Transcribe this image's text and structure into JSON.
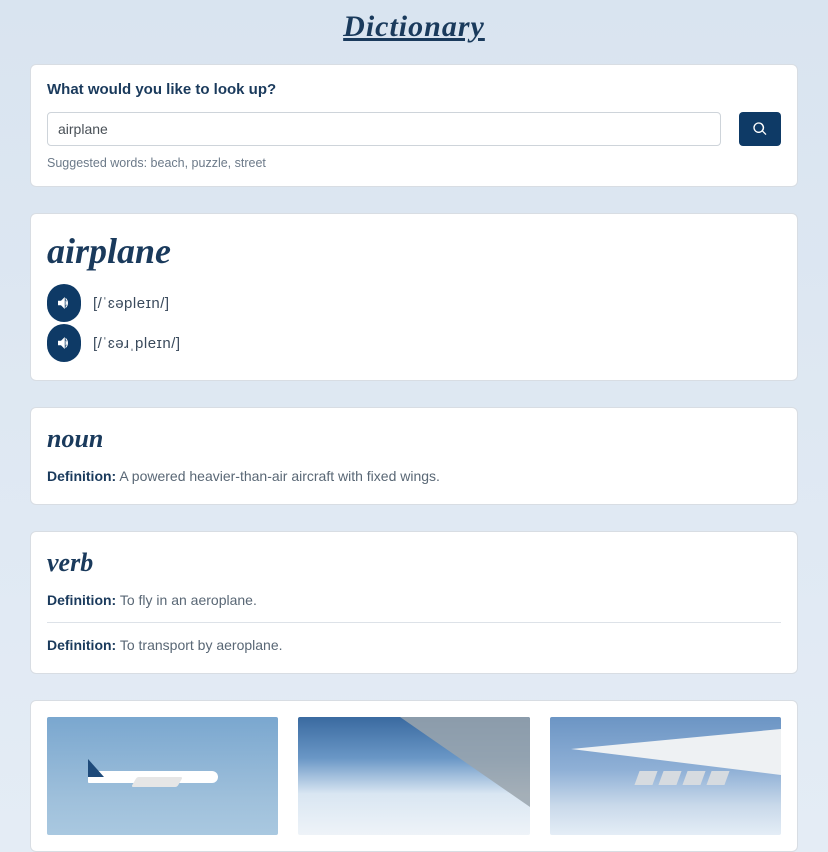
{
  "title": "Dictionary",
  "search": {
    "prompt": "What would you like to look up?",
    "value": "airplane",
    "suggestions": "Suggested words: beach, puzzle, street"
  },
  "entry": {
    "word": "airplane",
    "phonetics": [
      {
        "ipa": "[/ˈɛəpleɪn/]"
      },
      {
        "ipa": "[/ˈɛəɹˌpleɪn/]"
      }
    ],
    "defs": [
      {
        "pos": "noun",
        "items": [
          {
            "label": "Definition:",
            "text": " A powered heavier-than-air aircraft with fixed wings."
          }
        ]
      },
      {
        "pos": "verb",
        "items": [
          {
            "label": "Definition:",
            "text": " To fly in an aeroplane."
          },
          {
            "label": "Definition:",
            "text": " To transport by aeroplane."
          }
        ]
      }
    ]
  },
  "images": [
    {
      "alt": "airplane-in-sky"
    },
    {
      "alt": "airplane-wing-above-clouds"
    },
    {
      "alt": "airplane-wing-rainbow"
    }
  ]
}
